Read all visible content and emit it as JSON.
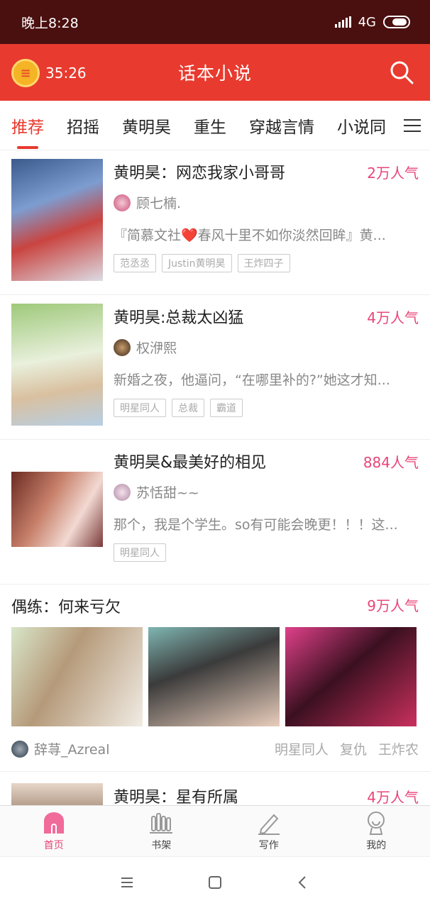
{
  "status": {
    "time": "晚上8:28",
    "network": "4G"
  },
  "header": {
    "timer": "35:26",
    "title": "话本小说"
  },
  "tabs": [
    "推荐",
    "招摇",
    "黄明昊",
    "重生",
    "穿越言情",
    "小说同"
  ],
  "books": [
    {
      "title": "黄明昊：网恋我家小哥哥",
      "popularity": "2万人气",
      "author": "顾七楠.",
      "desc": "『简慕文社❤️春风十里不如你淡然回眸』黄...",
      "tags": [
        "范丞丞",
        "Justin黄明昊",
        "王炸四子"
      ]
    },
    {
      "title": "黄明昊:总裁太凶猛",
      "popularity": "4万人气",
      "author": "权洢熙",
      "desc": "新婚之夜，他逼问，“在哪里补的?”她这才知...",
      "tags": [
        "明星同人",
        "总裁",
        "霸道"
      ]
    },
    {
      "title": "黄明昊&最美好的相见",
      "popularity": "884人气",
      "author": "苏恬甜~~",
      "desc": "那个，我是个学生。so有可能会晚更！！！这...",
      "tags": [
        "明星同人"
      ]
    }
  ],
  "featured": {
    "title": "偶练：何来亏欠",
    "popularity": "9万人气",
    "author": "辞荨_Azreal",
    "tags": [
      "明星同人",
      "复仇",
      "王炸农"
    ]
  },
  "partial_book": {
    "title": "黄明昊：星有所属",
    "popularity": "4万人气"
  },
  "bottom_nav": [
    {
      "label": "首页",
      "icon": "home-icon"
    },
    {
      "label": "书架",
      "icon": "bookshelf-icon"
    },
    {
      "label": "写作",
      "icon": "pen-icon"
    },
    {
      "label": "我的",
      "icon": "profile-icon"
    }
  ],
  "colors": {
    "accent": "#e83a2e",
    "popularity": "#e8457a",
    "statusbar": "#4a0f0f"
  }
}
